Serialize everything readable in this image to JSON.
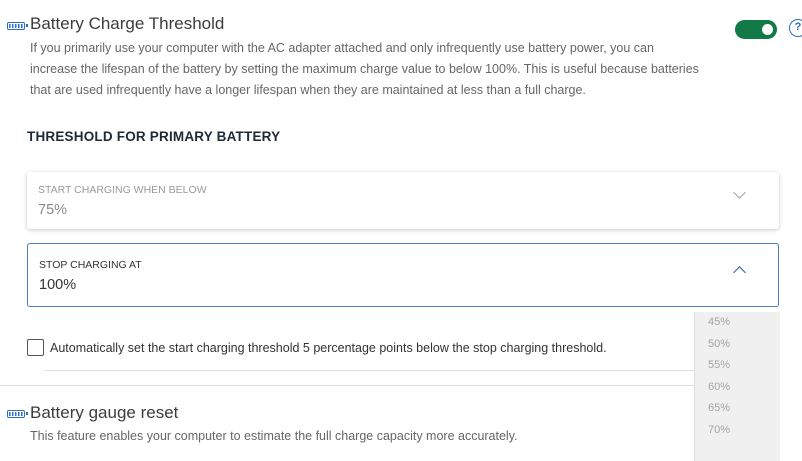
{
  "threshold": {
    "title": "Battery Charge Threshold",
    "description_lines": [
      "If you primarily use your computer with the AC adapter attached and only infrequently use battery power, you can",
      "increase the lifespan of the battery by setting the maximum charge value to below 100%. This is useful because batteries",
      "that are used infrequently have a longer lifespan when they are maintained at less than a full charge."
    ],
    "enabled": true,
    "toggle_color": "#117a46",
    "help_glyph": "?"
  },
  "primary": {
    "heading": "THRESHOLD FOR PRIMARY BATTERY",
    "start": {
      "label": "START CHARGING WHEN BELOW",
      "value": "75%"
    },
    "stop": {
      "label": "STOP CHARGING AT",
      "value": "100%"
    },
    "stop_options": [
      "45%",
      "50%",
      "55%",
      "60%",
      "65%",
      "70%"
    ],
    "auto_checkbox_label": "Automatically set the start charging threshold 5 percentage points below the stop charging threshold.",
    "auto_checked": false
  },
  "gauge": {
    "title": "Battery gauge reset",
    "description": "This feature enables your computer to estimate the full charge capacity more accurately."
  },
  "colors": {
    "accent": "#2a6ebf",
    "toggle_on": "#117a46"
  }
}
